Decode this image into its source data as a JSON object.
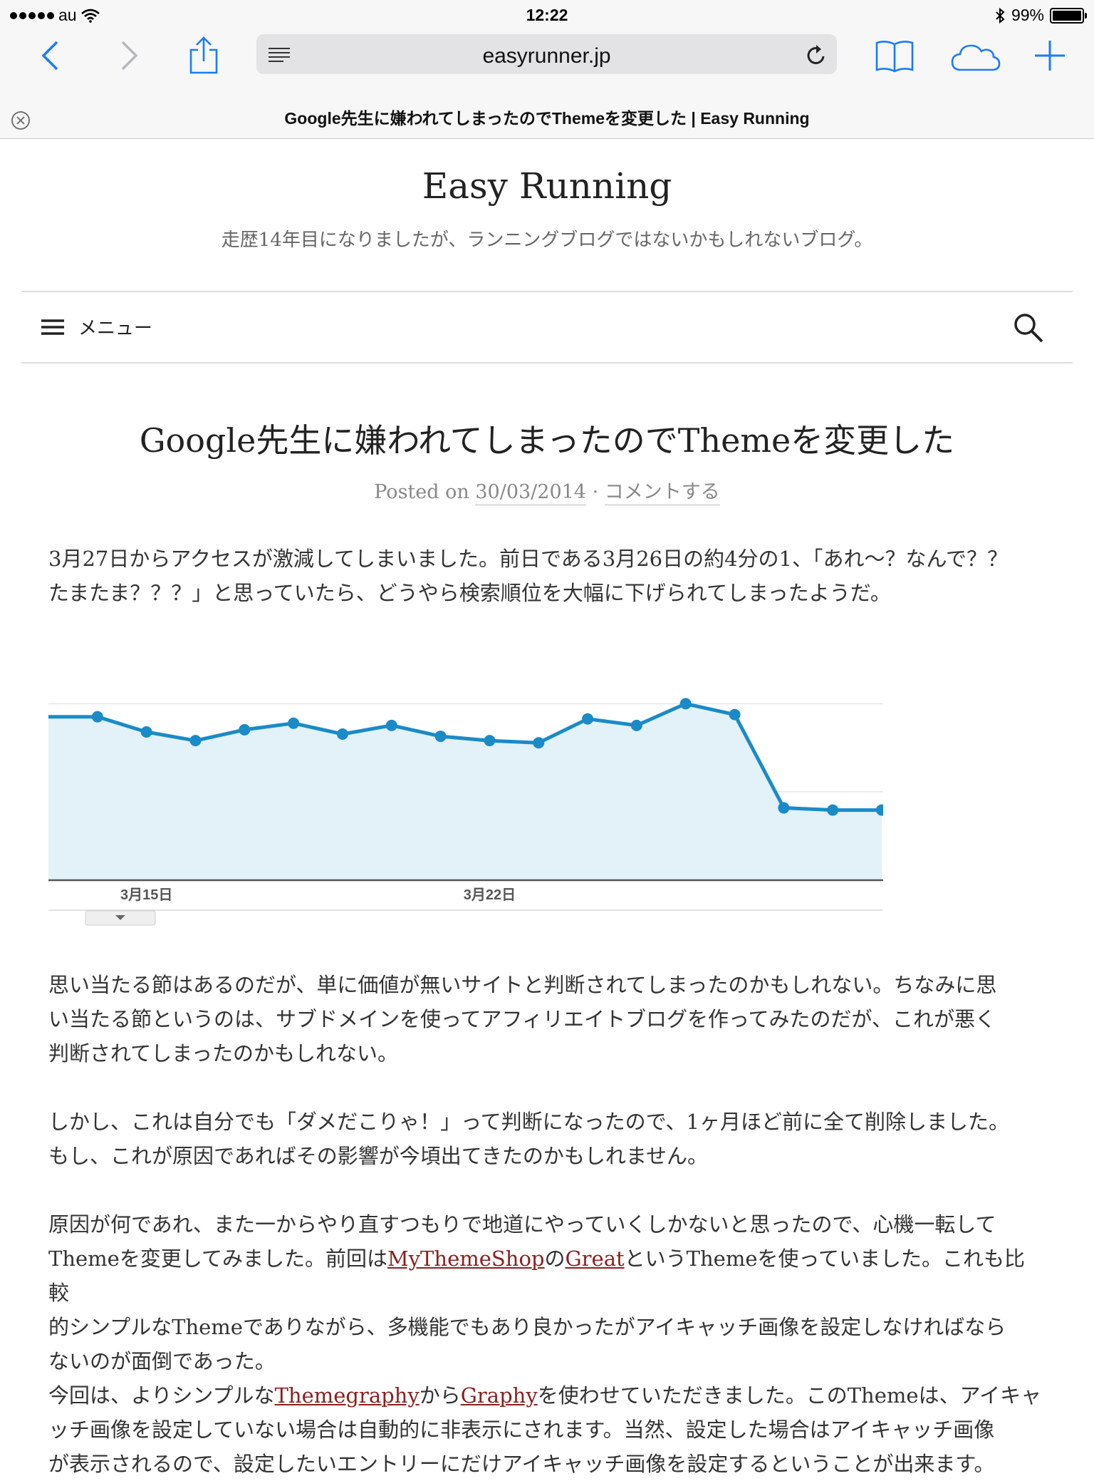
{
  "status_bar": {
    "carrier": "au",
    "time": "12:22",
    "battery": "99%",
    "battery_level": 0.99
  },
  "browser": {
    "url": "easyrunner.jp",
    "tab_title": "Google先生に嫌われてしまったのでThemeを変更した | Easy Running"
  },
  "site": {
    "title": "Easy Running",
    "description": "走歴14年目になりましたが、ランニングブログではないかもしれないブログ。",
    "menu_label": "メニュー"
  },
  "post": {
    "title": "Google先生に嫌われてしまったのでThemeを変更した",
    "meta_prefix": "Posted on",
    "date": "30/03/2014",
    "meta_sep": "·",
    "comment_link": "コメントする",
    "p1_line1": "3月27日からアクセスが激減してしまいました。前日である3月26日の約4分の1、「あれ〜？なんで？？",
    "p1_line2": "たまたま？？？」と思っていたら、どうやら検索順位を大幅に下げられてしまったようだ。",
    "p2_line1": "思い当たる節はあるのだが、単に価値が無いサイトと判断されてしまったのかもしれない。ちなみに思",
    "p2_line2": "い当たる節というのは、サブドメインを使ってアフィリエイトブログを作ってみたのだが、これが悪く",
    "p2_line3": "判断されてしまったのかもしれない。",
    "p3_line1": "しかし、これは自分でも「ダメだこりゃ！」って判断になったので、1ヶ月ほど前に全て削除しました。",
    "p3_line2": "もし、これが原因であればその影響が今頃出てきたのかもしれません。",
    "p4_line1": "原因が何であれ、また一からやり直すつもりで地道にやっていくしかないと思ったので、心機一転して",
    "p4_line2_a": "Themeを変更してみました。前回は",
    "p4_link1": "MyThemeShop",
    "p4_line2_b": "の",
    "p4_link2": "Great",
    "p4_line2_c": "というThemeを使っていました。これも比較",
    "p4_line3": "的シンプルなThemeでありながら、多機能でもあり良かったがアイキャッチ画像を設定しなければなら",
    "p4_line4": "ないのが面倒であった。",
    "p5_line1_a": "今回は、よりシンプルな",
    "p5_link1": "Themegraphy",
    "p5_line1_b": "から",
    "p5_link2": "Graphy",
    "p5_line1_c": "を使わせていただきました。このThemeは、アイキャ",
    "p5_line2": "ッチ画像を設定していない場合は自動的に非表示にされます。当然、設定した場合はアイキャッチ画像",
    "p5_line3": "が表示されるので、設定したいエントリーにだけアイキャッチ画像を設定するということが出来ます。"
  },
  "chart_data": {
    "type": "area",
    "tick_labels": [
      "3月15日",
      "3月22日"
    ],
    "values": [
      75,
      75,
      68,
      64,
      69,
      72,
      67,
      71,
      66,
      64,
      63,
      74,
      71,
      81,
      76,
      33,
      32,
      32
    ],
    "ylim": [
      0,
      90
    ],
    "grid": true,
    "line_color": "#1a8bc7",
    "fill_color": "#e3f1f8"
  }
}
